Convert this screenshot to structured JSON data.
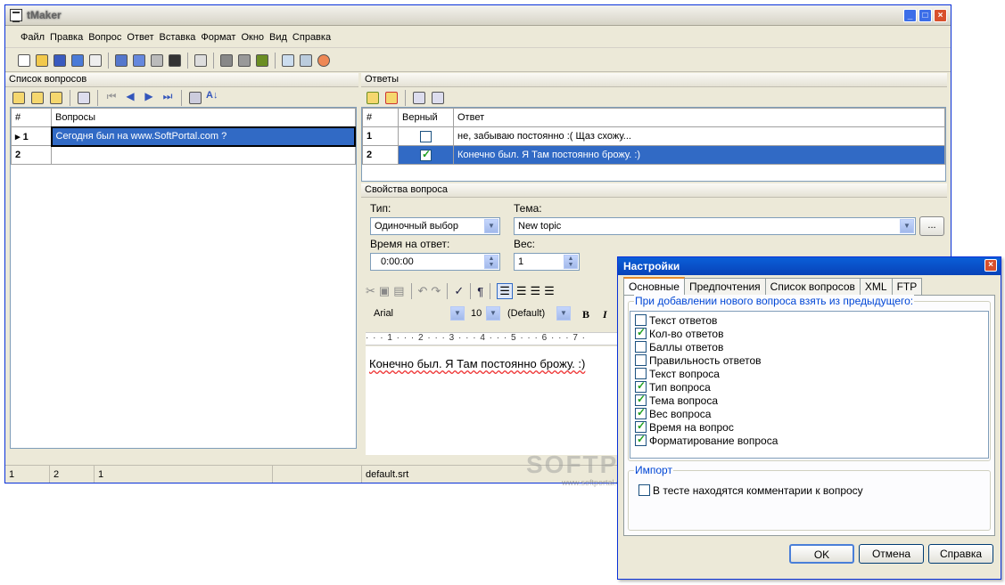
{
  "window": {
    "title": "tMaker"
  },
  "menu": [
    "Файл",
    "Правка",
    "Вопрос",
    "Ответ",
    "Вставка",
    "Формат",
    "Окно",
    "Вид",
    "Справка"
  ],
  "questions_panel": {
    "header": "Список вопросов",
    "columns": [
      "#",
      "Вопросы"
    ],
    "rows": [
      {
        "num": "1",
        "text": "Сегодня был на www.SoftPortal.com ?"
      },
      {
        "num": "2",
        "text": ""
      }
    ]
  },
  "answers_panel": {
    "header": "Ответы",
    "columns": [
      "#",
      "Верный",
      "Ответ"
    ],
    "rows": [
      {
        "num": "1",
        "correct": false,
        "text": "не, забываю постоянно :( Щаз схожу..."
      },
      {
        "num": "2",
        "correct": true,
        "text": "Конечно был. Я Там постоянно брожу. :)"
      }
    ]
  },
  "props": {
    "header": "Свойства вопроса",
    "type_label": "Тип:",
    "type_value": "Одиночный выбор",
    "topic_label": "Тема:",
    "topic_value": "New topic",
    "topic_btn": "...",
    "time_label": "Время на ответ:",
    "time_value": "0:00:00",
    "weight_label": "Вес:",
    "weight_value": "1"
  },
  "editor": {
    "font": "Arial",
    "size": "10",
    "style": "(Default)",
    "bold": "B",
    "italic": "I",
    "ruler": "· · · 1 · · · 2 · · · 3 · · · 4 · · · 5 · · · 6 · · · 7 ·",
    "text": "Конечно был. Я Там постоянно брожу. :)"
  },
  "status": [
    "1",
    "2",
    "1",
    "",
    "default.srt"
  ],
  "watermark": {
    "main": "SOFTPORTAL",
    "sub": "www.softportal.com"
  },
  "dialog": {
    "title": "Настройки",
    "tabs": [
      "Основные",
      "Предпочтения",
      "Список вопросов",
      "XML",
      "FTP"
    ],
    "group1_label": "При добавлении нового вопроса взять из предыдущего:",
    "items": [
      {
        "label": "Текст ответов",
        "checked": false
      },
      {
        "label": "Кол-во ответов",
        "checked": true
      },
      {
        "label": "Баллы ответов",
        "checked": false
      },
      {
        "label": "Правильность ответов",
        "checked": false
      },
      {
        "label": "Текст вопроса",
        "checked": false
      },
      {
        "label": "Тип вопроса",
        "checked": true
      },
      {
        "label": "Тема вопроса",
        "checked": true
      },
      {
        "label": "Вес вопроса",
        "checked": true
      },
      {
        "label": "Время на вопрос",
        "checked": true
      },
      {
        "label": "Форматирование вопроса",
        "checked": true
      }
    ],
    "group2_label": "Импорт",
    "import_item": {
      "label": "В тесте находятся комментарии к вопросу",
      "checked": false
    },
    "buttons": {
      "ok": "OK",
      "cancel": "Отмена",
      "help": "Справка"
    }
  }
}
